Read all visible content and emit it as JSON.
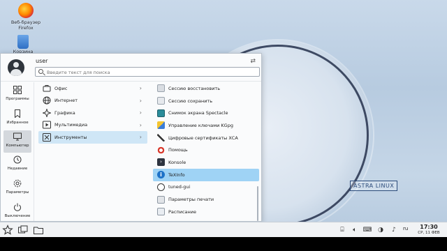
{
  "desktop": {
    "icons": [
      {
        "label_line1": "Веб-браузер",
        "label_line2": "Firefox",
        "icon": "firefox-icon"
      },
      {
        "label": "Корзина",
        "icon": "trash-icon"
      }
    ],
    "watermark": "ASTRA LINUX"
  },
  "menu": {
    "user": "user",
    "search_placeholder": "Введите текст для поиска",
    "nav": [
      {
        "label": "Программы",
        "icon": "apps-grid-icon"
      },
      {
        "label": "Избранное",
        "icon": "bookmark-icon"
      },
      {
        "label": "Компьютер",
        "icon": "monitor-icon",
        "active": true
      },
      {
        "label": "Недавние",
        "icon": "history-icon"
      },
      {
        "label": "Параметры",
        "icon": "settings-icon"
      },
      {
        "label": "Выключение",
        "icon": "power-icon"
      }
    ],
    "categories": [
      {
        "label": "Офис",
        "icon": "office-icon"
      },
      {
        "label": "Интернет",
        "icon": "globe-icon"
      },
      {
        "label": "Графика",
        "icon": "graphics-icon"
      },
      {
        "label": "Мультимедиа",
        "icon": "multimedia-icon"
      },
      {
        "label": "Инструменты",
        "icon": "tools-icon",
        "selected": true
      }
    ],
    "apps": [
      {
        "label": "Сессию восстановить",
        "icon": "session-restore-icon"
      },
      {
        "label": "Сессию сохранить",
        "icon": "session-save-icon"
      },
      {
        "label": "Снимок экрана Spectacle",
        "icon": "spectacle-icon"
      },
      {
        "label": "Управление ключами KGpg",
        "icon": "kgpg-icon"
      },
      {
        "label": "Цифровые сертификаты ХСА",
        "icon": "certificate-icon"
      },
      {
        "label": "Помощь",
        "icon": "help-icon"
      },
      {
        "label": "Konsole",
        "icon": "terminal-icon"
      },
      {
        "label": "TeXInfo",
        "icon": "info-icon",
        "selected": true
      },
      {
        "label": "tuned-gui",
        "icon": "tuned-icon"
      },
      {
        "label": "Параметры печати",
        "icon": "printer-icon"
      },
      {
        "label": "Расписание",
        "icon": "schedule-icon"
      }
    ]
  },
  "taskbar": {
    "lang": "ru",
    "time": "17:30",
    "date": "СР, 11 ФЕВ"
  },
  "colors": {
    "selection": "#cfe6f6",
    "app_selection": "#9fd3f5"
  }
}
